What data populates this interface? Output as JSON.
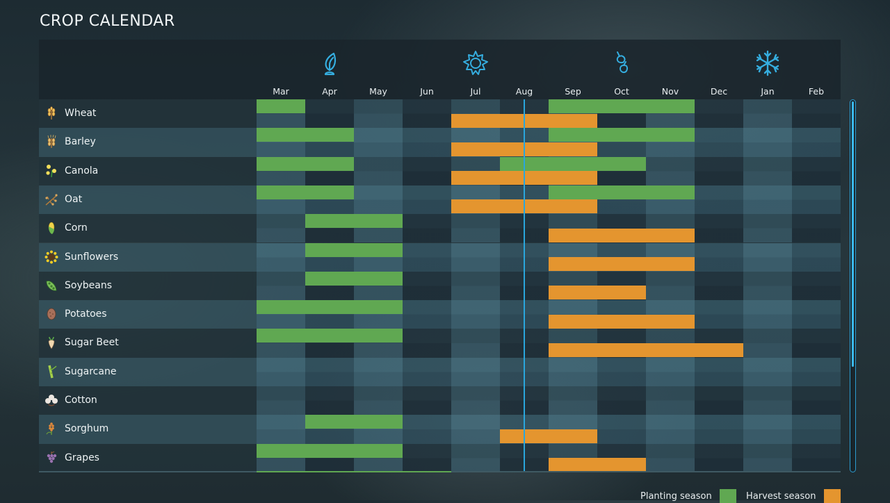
{
  "title": "CROP CALENDAR",
  "colors": {
    "planting": "#60a852",
    "harvest": "#e4952f",
    "accent": "#2aa6dc",
    "season_icon": "#35aee0"
  },
  "months": [
    "Mar",
    "Apr",
    "May",
    "Jun",
    "Jul",
    "Aug",
    "Sep",
    "Oct",
    "Nov",
    "Dec",
    "Jan",
    "Feb"
  ],
  "seasons": [
    {
      "name": "spring",
      "icon": "sprout-icon",
      "month_index": 1
    },
    {
      "name": "summer",
      "icon": "sun-icon",
      "month_index": 4
    },
    {
      "name": "autumn",
      "icon": "leaves-icon",
      "month_index": 7
    },
    {
      "name": "winter",
      "icon": "snowflake-icon",
      "month_index": 10
    }
  ],
  "current_date": {
    "month": "Aug",
    "month_index": 5,
    "fraction_of_month": 0.5
  },
  "crops": [
    {
      "name": "Wheat",
      "icon": "wheat-icon",
      "planting": [
        [
          0,
          0
        ],
        [
          6,
          8
        ]
      ],
      "harvest": [
        [
          4,
          6
        ]
      ]
    },
    {
      "name": "Barley",
      "icon": "barley-icon",
      "planting": [
        [
          0,
          1
        ],
        [
          6,
          8
        ]
      ],
      "harvest": [
        [
          4,
          6
        ]
      ]
    },
    {
      "name": "Canola",
      "icon": "canola-icon",
      "planting": [
        [
          0,
          1
        ],
        [
          5,
          7
        ]
      ],
      "harvest": [
        [
          4,
          6
        ]
      ]
    },
    {
      "name": "Oat",
      "icon": "oat-icon",
      "planting": [
        [
          0,
          1
        ],
        [
          6,
          8
        ]
      ],
      "harvest": [
        [
          4,
          6
        ]
      ]
    },
    {
      "name": "Corn",
      "icon": "corn-icon",
      "planting": [
        [
          1,
          2
        ]
      ],
      "harvest": [
        [
          6,
          8
        ]
      ]
    },
    {
      "name": "Sunflowers",
      "icon": "sunflower-icon",
      "planting": [
        [
          1,
          2
        ]
      ],
      "harvest": [
        [
          6,
          8
        ]
      ]
    },
    {
      "name": "Soybeans",
      "icon": "soybeans-icon",
      "planting": [
        [
          1,
          2
        ]
      ],
      "harvest": [
        [
          6,
          7
        ]
      ]
    },
    {
      "name": "Potatoes",
      "icon": "potato-icon",
      "planting": [
        [
          0,
          2
        ]
      ],
      "harvest": [
        [
          6,
          8
        ]
      ]
    },
    {
      "name": "Sugar Beet",
      "icon": "sugar-beet-icon",
      "planting": [
        [
          0,
          2
        ]
      ],
      "harvest": [
        [
          6,
          9
        ]
      ]
    },
    {
      "name": "Sugarcane",
      "icon": "sugarcane-icon",
      "planting": [],
      "harvest": []
    },
    {
      "name": "Cotton",
      "icon": "cotton-icon",
      "planting": [],
      "harvest": []
    },
    {
      "name": "Sorghum",
      "icon": "sorghum-icon",
      "planting": [
        [
          1,
          2
        ]
      ],
      "harvest": [
        [
          5,
          6
        ]
      ]
    },
    {
      "name": "Grapes",
      "icon": "grapes-icon",
      "planting": [
        [
          0,
          2
        ]
      ],
      "harvest": [
        [
          6,
          7
        ]
      ]
    }
  ],
  "partial_next_row": {
    "planting": [
      [
        0,
        3
      ]
    ]
  },
  "scrollbar": {
    "visible_fraction": 0.72,
    "position": 0
  },
  "legend": {
    "planting_label": "Planting season",
    "harvest_label": "Harvest season"
  }
}
